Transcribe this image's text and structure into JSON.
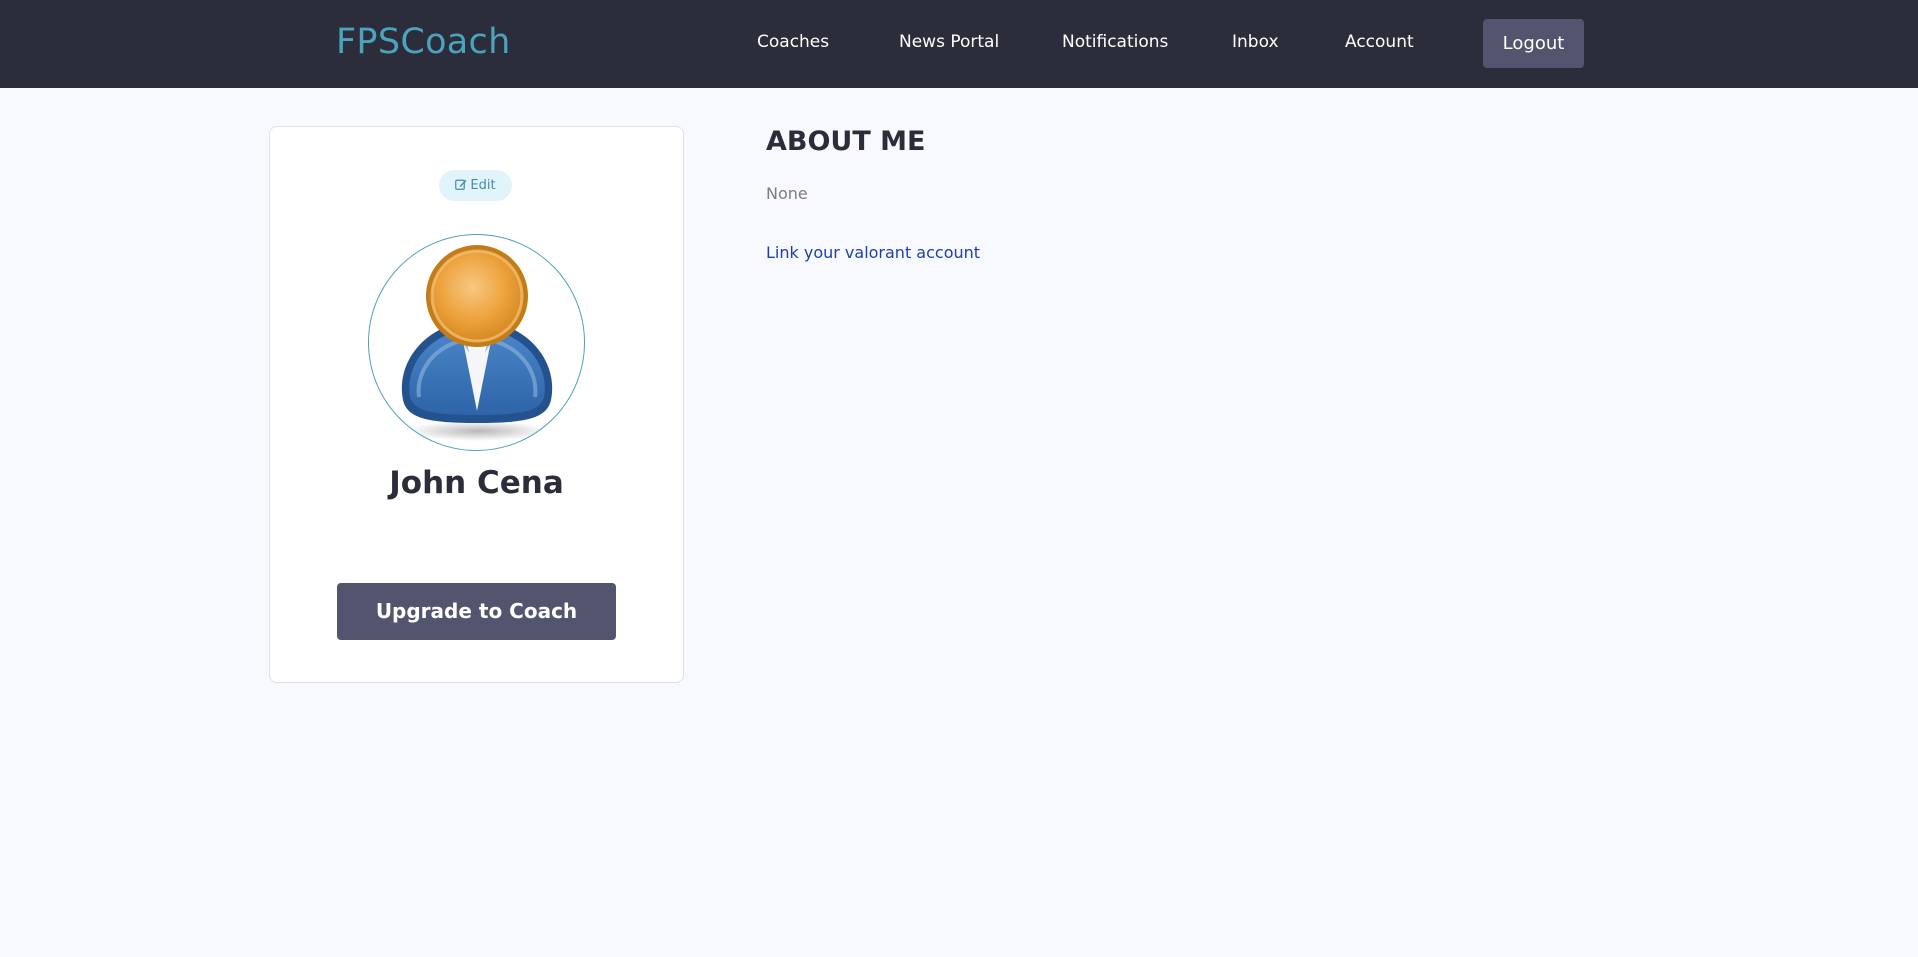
{
  "header": {
    "brand": "FPSCoach",
    "nav": {
      "coaches": "Coaches",
      "news_portal": "News Portal",
      "notifications": "Notifications",
      "inbox": "Inbox",
      "account": "Account"
    },
    "logout_label": "Logout"
  },
  "profile": {
    "edit_label": "Edit",
    "edit_icon": "edit-icon",
    "avatar_icon": "user-avatar",
    "name": "John Cena",
    "upgrade_label": "Upgrade to Coach"
  },
  "about": {
    "title": "ABOUT ME",
    "text": "None",
    "link_label": "Link your valorant account"
  },
  "colors": {
    "navbar": "#2b2d3a",
    "brand": "#4ba3bd",
    "button": "#53556f",
    "link": "#1f3ea8",
    "background": "#f7f9ff"
  }
}
